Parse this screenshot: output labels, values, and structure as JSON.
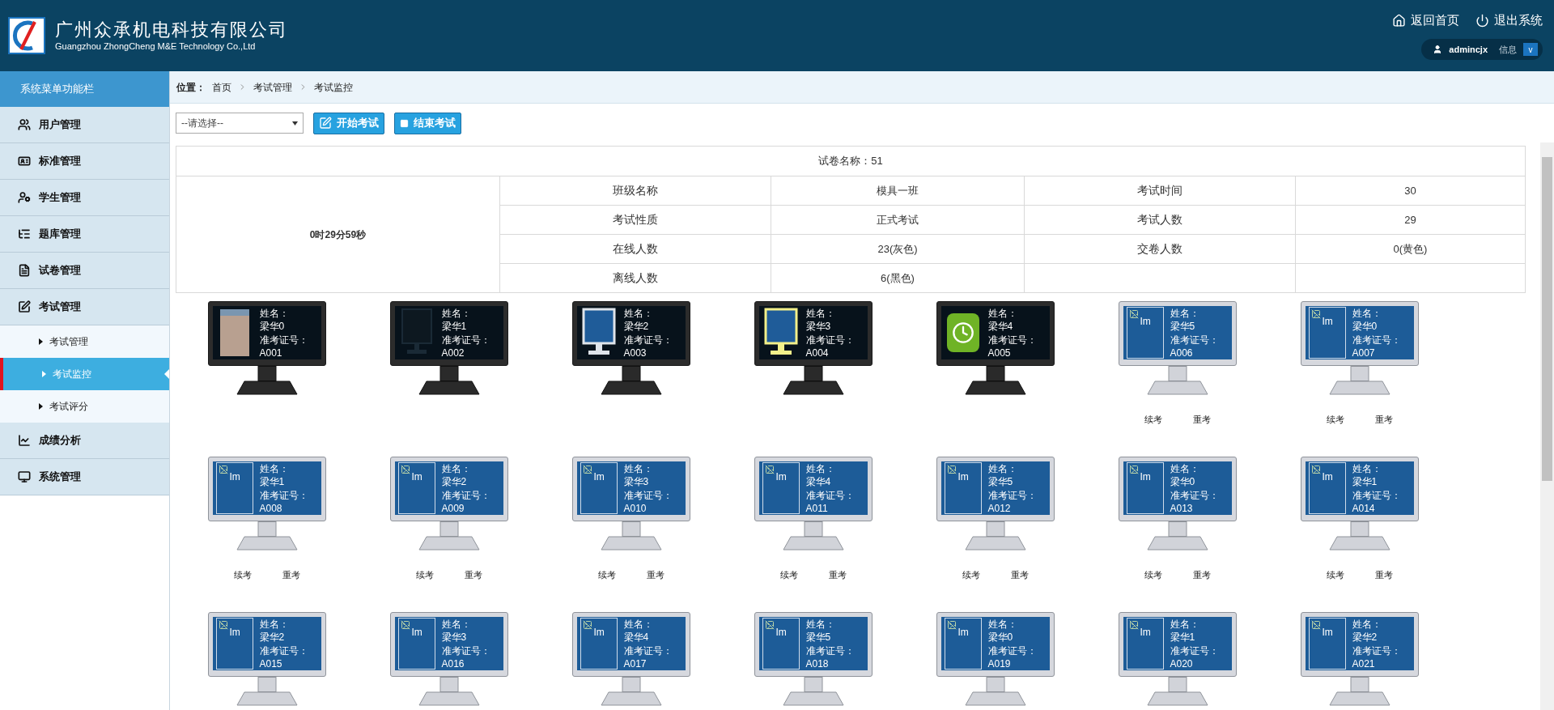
{
  "header": {
    "company_name": "广州众承机电科技有限公司",
    "company_name_en": "Guangzhou ZhongCheng M&E Technology Co.,Ltd",
    "links": [
      {
        "label": "返回首页"
      },
      {
        "label": "退出系统"
      }
    ],
    "user": {
      "name": "admincjx",
      "info": "信息",
      "toggle": "v"
    }
  },
  "sidebar": {
    "title": "系统菜单功能栏",
    "items": [
      {
        "label": "用户管理"
      },
      {
        "label": "标准管理"
      },
      {
        "label": "学生管理"
      },
      {
        "label": "题库管理"
      },
      {
        "label": "试卷管理"
      },
      {
        "label": "考试管理",
        "children": [
          {
            "label": "考试管理",
            "selected": false
          },
          {
            "label": "考试监控",
            "selected": true
          },
          {
            "label": "考试评分",
            "selected": false
          }
        ]
      },
      {
        "label": "成绩分析"
      },
      {
        "label": "系统管理"
      }
    ]
  },
  "breadcrumb": {
    "label": "位置：",
    "items": [
      "首页",
      "考试管理",
      "考试监控"
    ]
  },
  "toolbar": {
    "select": {
      "value": "--请选择--"
    },
    "buttons": [
      {
        "label": "开始考试"
      },
      {
        "label": "结束考试"
      }
    ]
  },
  "summary": {
    "paper": "试卷名称：51",
    "timer": "0时29分59秒",
    "rows": [
      [
        "班级名称",
        "模具一班",
        "考试时间",
        "30"
      ],
      [
        "考试性质",
        "正式考试",
        "考试人数",
        "29"
      ],
      [
        "在线人数",
        "23(灰色)",
        "交卷人数",
        "0(黄色)"
      ],
      [
        "离线人数",
        "6(黑色)"
      ]
    ]
  },
  "students": [
    {
      "name_label": "姓名：",
      "name": "梁华0",
      "id_label": "准考证号：",
      "id": "A001",
      "online": false,
      "kind": "photo"
    },
    {
      "name_label": "姓名：",
      "name": "梁华1",
      "id_label": "准考证号：",
      "id": "A002",
      "online": false,
      "kind": "dark"
    },
    {
      "name_label": "姓名：",
      "name": "梁华2",
      "id_label": "准考证号：",
      "id": "A003",
      "online": false,
      "kind": "light"
    },
    {
      "name_label": "姓名：",
      "name": "梁华3",
      "id_label": "准考证号：",
      "id": "A004",
      "online": false,
      "kind": "yellow"
    },
    {
      "name_label": "姓名：",
      "name": "梁华4",
      "id_label": "准考证号：",
      "id": "A005",
      "online": false,
      "kind": "clock"
    },
    {
      "name_label": "姓名：",
      "name": "梁华5",
      "id_label": "准考证号：",
      "id": "A006",
      "online": true,
      "kind": "broken",
      "alt": "Im",
      "actions": [
        "续考",
        "重考"
      ]
    },
    {
      "name_label": "姓名：",
      "name": "梁华0",
      "id_label": "准考证号：",
      "id": "A007",
      "online": true,
      "kind": "broken",
      "alt": "Im",
      "actions": [
        "续考",
        "重考"
      ]
    },
    {
      "name_label": "姓名：",
      "name": "梁华1",
      "id_label": "准考证号：",
      "id": "A008",
      "online": true,
      "kind": "broken",
      "alt": "Im",
      "actions": [
        "续考",
        "重考"
      ]
    },
    {
      "name_label": "姓名：",
      "name": "梁华2",
      "id_label": "准考证号：",
      "id": "A009",
      "online": true,
      "kind": "broken",
      "alt": "Im",
      "actions": [
        "续考",
        "重考"
      ]
    },
    {
      "name_label": "姓名：",
      "name": "梁华3",
      "id_label": "准考证号：",
      "id": "A010",
      "online": true,
      "kind": "broken",
      "alt": "Im",
      "actions": [
        "续考",
        "重考"
      ]
    },
    {
      "name_label": "姓名：",
      "name": "梁华4",
      "id_label": "准考证号：",
      "id": "A011",
      "online": true,
      "kind": "broken",
      "alt": "Im",
      "actions": [
        "续考",
        "重考"
      ]
    },
    {
      "name_label": "姓名：",
      "name": "梁华5",
      "id_label": "准考证号：",
      "id": "A012",
      "online": true,
      "kind": "broken",
      "alt": "Im",
      "actions": [
        "续考",
        "重考"
      ]
    },
    {
      "name_label": "姓名：",
      "name": "梁华0",
      "id_label": "准考证号：",
      "id": "A013",
      "online": true,
      "kind": "broken",
      "alt": "Im",
      "actions": [
        "续考",
        "重考"
      ]
    },
    {
      "name_label": "姓名：",
      "name": "梁华1",
      "id_label": "准考证号：",
      "id": "A014",
      "online": true,
      "kind": "broken",
      "alt": "Im",
      "actions": [
        "续考",
        "重考"
      ]
    },
    {
      "name_label": "姓名：",
      "name": "梁华2",
      "id_label": "准考证号：",
      "id": "A015",
      "online": true,
      "kind": "broken",
      "alt": "Im"
    },
    {
      "name_label": "姓名：",
      "name": "梁华3",
      "id_label": "准考证号：",
      "id": "A016",
      "online": true,
      "kind": "broken",
      "alt": "Im"
    },
    {
      "name_label": "姓名：",
      "name": "梁华4",
      "id_label": "准考证号：",
      "id": "A017",
      "online": true,
      "kind": "broken",
      "alt": "Im"
    },
    {
      "name_label": "姓名：",
      "name": "梁华5",
      "id_label": "准考证号：",
      "id": "A018",
      "online": true,
      "kind": "broken",
      "alt": "Im"
    },
    {
      "name_label": "姓名：",
      "name": "梁华0",
      "id_label": "准考证号：",
      "id": "A019",
      "online": true,
      "kind": "broken",
      "alt": "Im"
    },
    {
      "name_label": "姓名：",
      "name": "梁华1",
      "id_label": "准考证号：",
      "id": "A020",
      "online": true,
      "kind": "broken",
      "alt": "Im"
    },
    {
      "name_label": "姓名：",
      "name": "梁华2",
      "id_label": "准考证号：",
      "id": "A021",
      "online": true,
      "kind": "broken",
      "alt": "Im"
    }
  ]
}
